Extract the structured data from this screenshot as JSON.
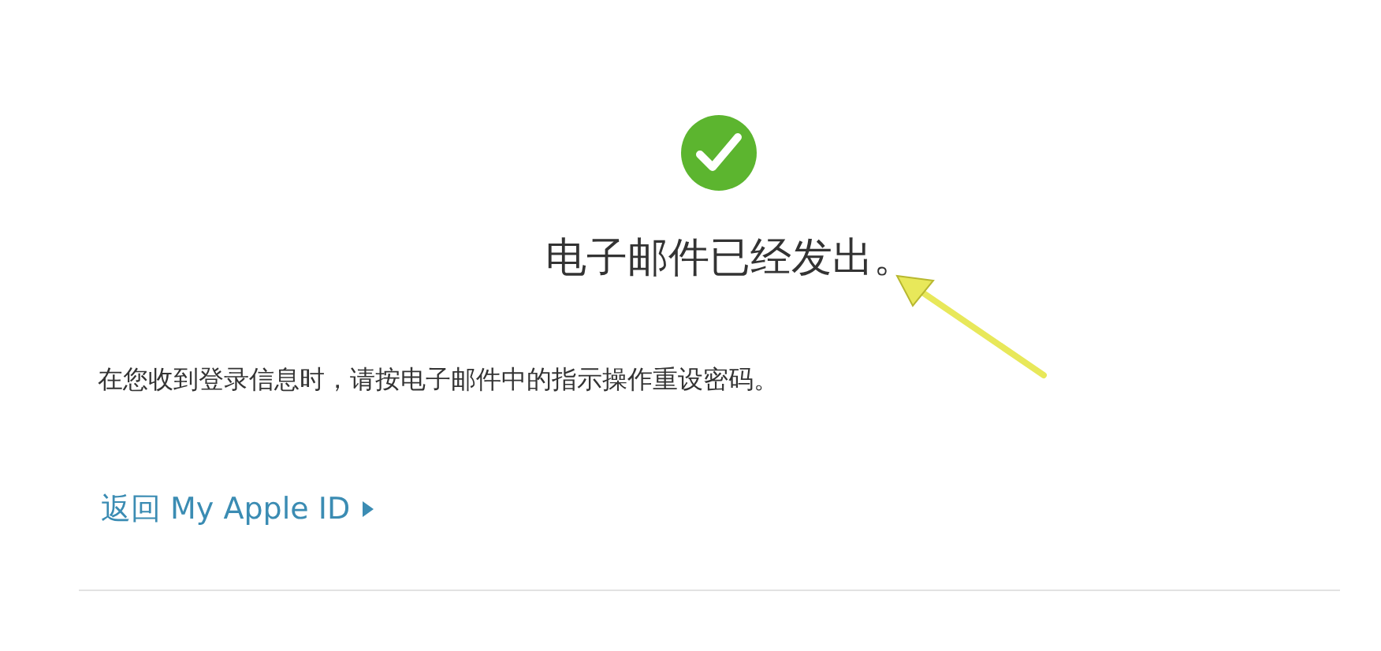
{
  "status": {
    "title": "电子邮件已经发出。",
    "message": "在您收到登录信息时，请按电子邮件中的指示操作重设密码。"
  },
  "link": {
    "label": "返回 My Apple ID"
  },
  "annotation": {
    "kind": "arrow"
  }
}
